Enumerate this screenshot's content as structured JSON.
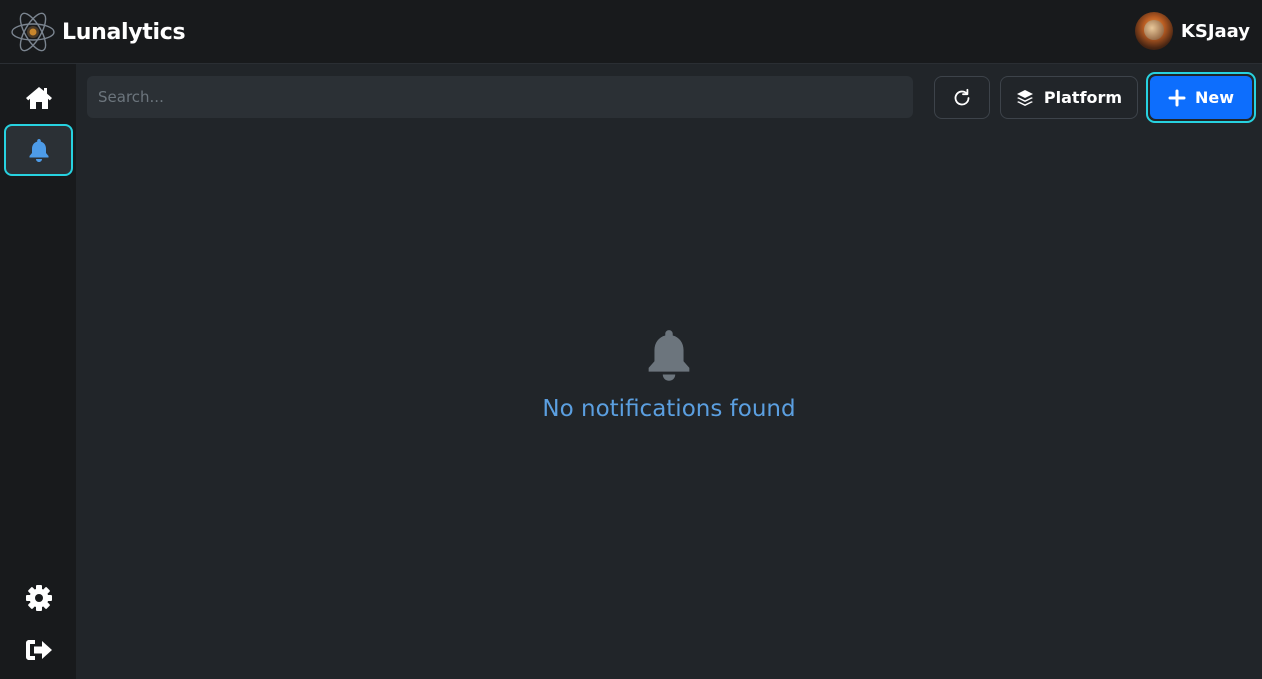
{
  "app": {
    "name": "Lunalytics",
    "logo_icon": "atom-logo-icon"
  },
  "user": {
    "name": "KSJaay",
    "avatar_icon": "avatar-image"
  },
  "sidebar": {
    "items": [
      {
        "icon": "home-icon",
        "active": false
      },
      {
        "icon": "bell-icon",
        "active": true
      }
    ],
    "bottom_items": [
      {
        "icon": "gear-icon"
      },
      {
        "icon": "logout-icon"
      }
    ]
  },
  "toolbar": {
    "search_placeholder": "Search...",
    "refresh_icon": "refresh-icon",
    "platform_label": "Platform",
    "platform_icon": "layers-icon",
    "new_label": "New",
    "new_icon": "plus-icon"
  },
  "main": {
    "empty_icon": "bell-icon",
    "empty_message": "No notifications found"
  },
  "colors": {
    "accent": "#27d2e0",
    "primary_button": "#0d6efd",
    "active_icon": "#4d9be8",
    "empty_text": "#5b9fe0",
    "background": "#212529",
    "sidebar": "#181a1c"
  }
}
